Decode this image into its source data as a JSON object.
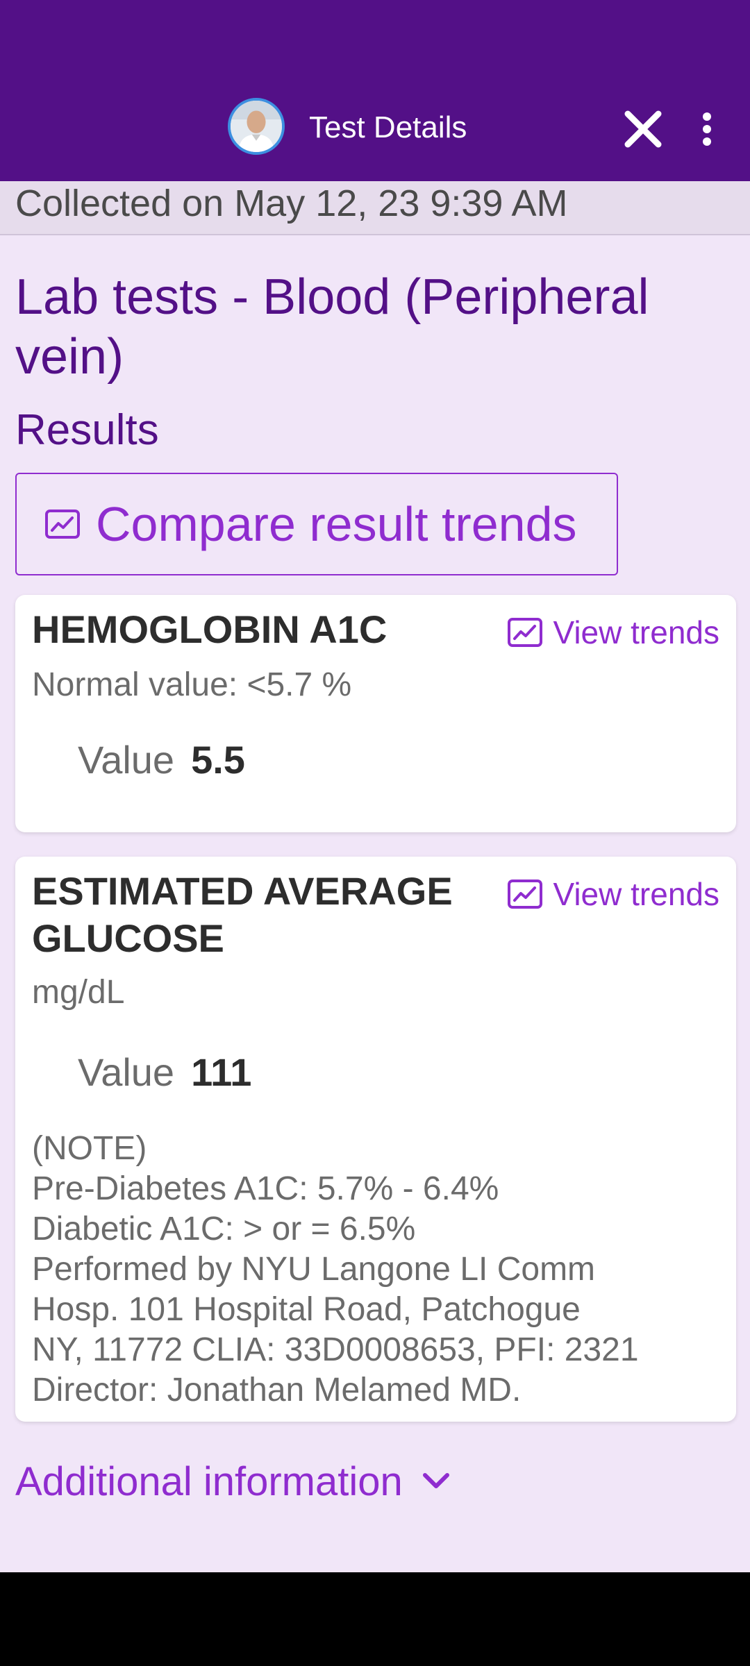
{
  "header": {
    "title": "Test Details",
    "avatar_icon": "user-avatar",
    "close_icon": "close-icon",
    "more_icon": "more-vertical-icon",
    "background_color": "#531087"
  },
  "collected": {
    "text": "Collected on May 12, 23 9:39 AM"
  },
  "page": {
    "title": "Lab tests - Blood (Peripheral vein)",
    "section_title": "Results",
    "compare_button_label": "Compare result trends",
    "compare_icon": "trend-chart-icon"
  },
  "results": [
    {
      "name": "HEMOGLOBIN A1C",
      "view_trends_label": "View trends",
      "subtitle": "Normal value: <5.7 %",
      "value_label": "Value",
      "value": "5.5"
    },
    {
      "name": "ESTIMATED AVERAGE GLUCOSE",
      "view_trends_label": "View trends",
      "subtitle": "mg/dL",
      "value_label": "Value",
      "value": "111",
      "note_lines": [
        "(NOTE)",
        "Pre-Diabetes A1C: 5.7% - 6.4%",
        "Diabetic A1C: > or = 6.5%",
        "Performed by NYU Langone LI Comm",
        "Hosp. 101 Hospital Road, Patchogue",
        "NY, 11772 CLIA: 33D0008653, PFI: 2321",
        "Director: Jonathan Melamed MD."
      ]
    }
  ],
  "additional_info": {
    "label": "Additional information",
    "icon": "chevron-down-icon"
  },
  "colors": {
    "accent": "#8f2ccf",
    "primary": "#531087",
    "page_background": "#f1e6f8"
  }
}
